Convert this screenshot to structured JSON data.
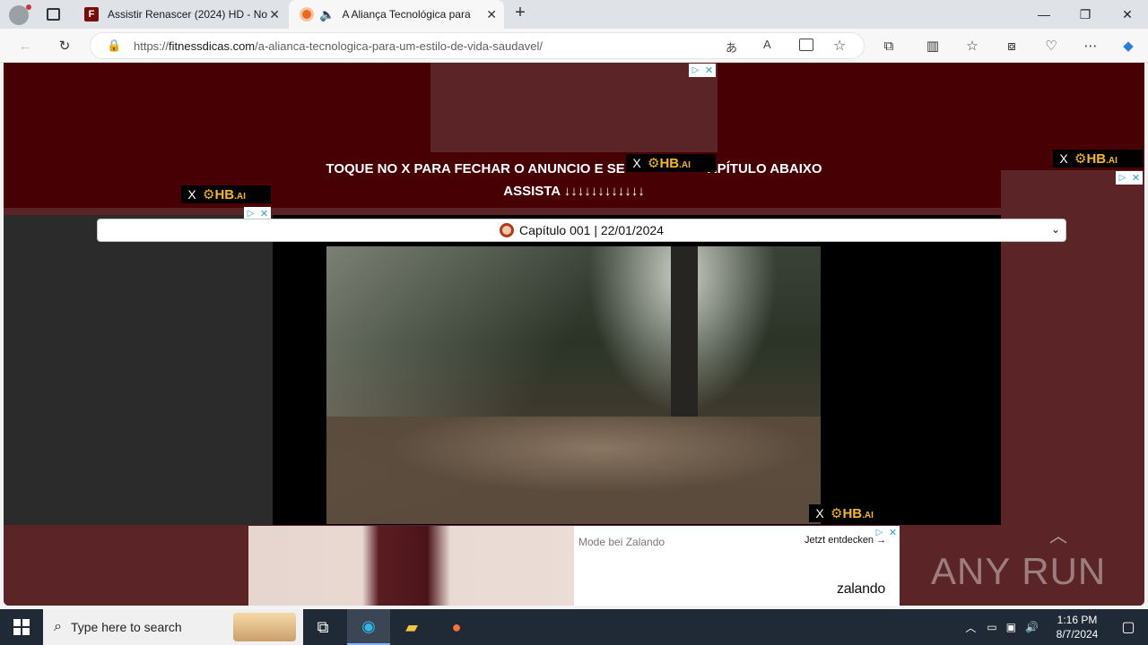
{
  "browser": {
    "tabs": [
      {
        "title": "Assistir Renascer (2024) HD - Nov",
        "active": false
      },
      {
        "title": "A Aliança Tecnológica para",
        "active": true
      }
    ],
    "url": {
      "scheme": "https://",
      "host": "fitnessdicas.com",
      "path": "/a-alianca-tecnologica-para-um-estilo-de-vida-saudavel/"
    }
  },
  "page": {
    "notice_line1": "TOQUE NO X PARA FECHAR O ANUNCIO E SE",
    "notice_line1_end": "APÍTULO ABAIXO",
    "notice_line2": "ASSISTA ↓↓↓↓↓↓↓↓↓↓↓↓",
    "episode_select": "Capítulo 001 | 22/01/2024",
    "hb_ad_label": "HB",
    "hb_ad_suffix": ".AI",
    "zalando": {
      "title": "Mode bei Zalando",
      "cta": "Jetzt entdecken →",
      "brand": "zalando"
    },
    "watermark": "ANY RUN"
  },
  "taskbar": {
    "search_placeholder": "Type here to search",
    "time": "1:16 PM",
    "date": "8/7/2024"
  }
}
